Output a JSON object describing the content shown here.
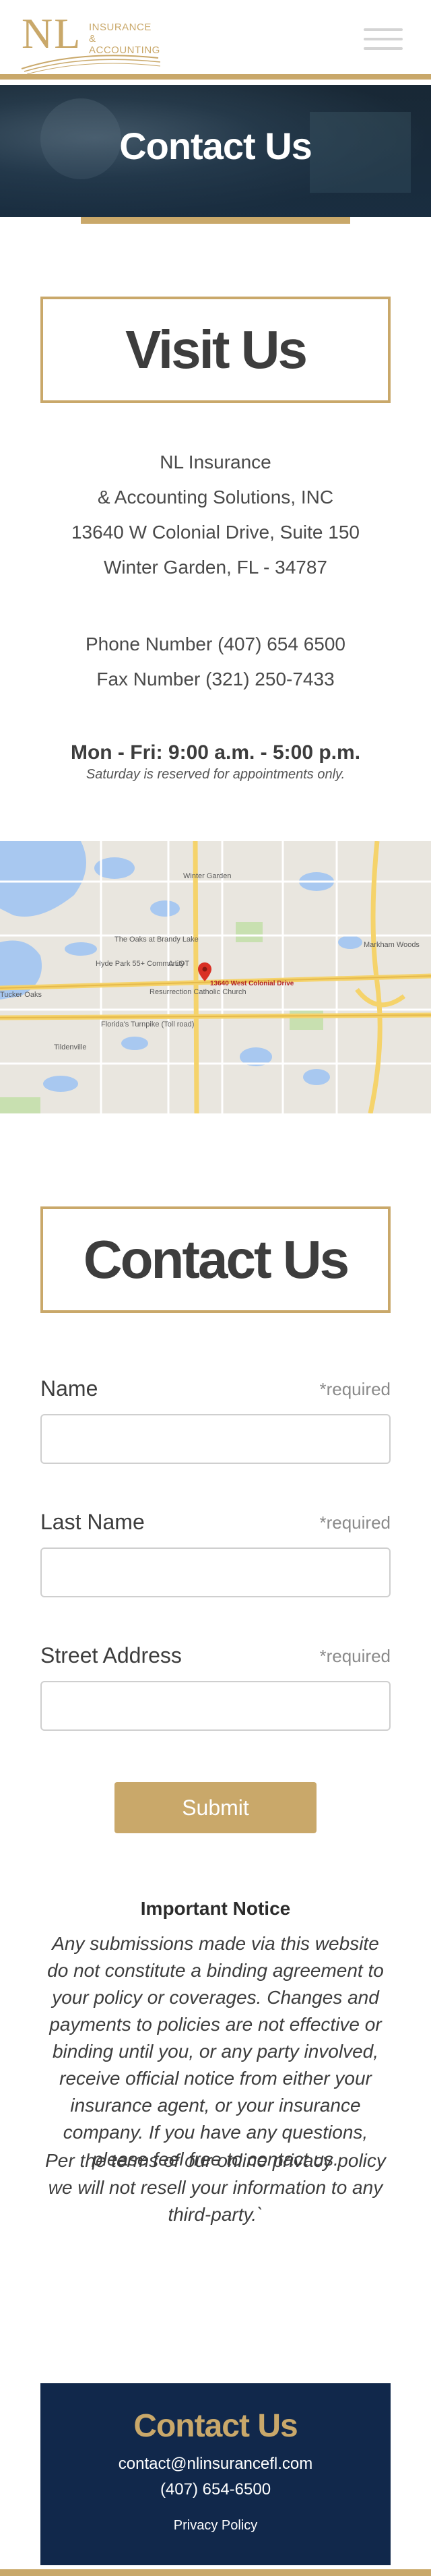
{
  "header": {
    "logo_letters": "NL",
    "logo_line1": "Insurance",
    "logo_line2": "& Accounting",
    "menu_icon": "hamburger-icon"
  },
  "hero": {
    "title": "Contact Us"
  },
  "visit": {
    "title": "Visit Us",
    "address": {
      "line1": "NL Insurance",
      "line2": "& Accounting Solutions, INC",
      "line3": "13640 W Colonial Drive, Suite 150",
      "line4": "Winter Garden, FL - 34787"
    },
    "phone": "Phone Number (407) 654 6500",
    "fax": "Fax Number (321) 250-7433",
    "hours": "Mon - Fri: 9:00 a.m. - 5:00 p.m.",
    "hours_note": "Saturday is reserved for appointments only."
  },
  "map": {
    "labels": {
      "winter_garden": "Winter Garden",
      "oaks": "The Oaks at Brandy Lake",
      "hyde_park": "Hyde Park 55+ Community",
      "alot": "A LOT",
      "resurrection": "Resurrection Catholic Church",
      "markham": "Markham Woods",
      "tucker": "Tucker Oaks",
      "tildenville": "Tildenville",
      "turnpike": "Florida's Turnpike (Toll road)",
      "pin": "13640 West Colonial Drive"
    },
    "pin_icon": "map-pin-icon"
  },
  "contact_form": {
    "title": "Contact Us",
    "required": "*required",
    "fields": {
      "name": {
        "label": "Name",
        "value": ""
      },
      "last_name": {
        "label": "Last Name",
        "value": ""
      },
      "street": {
        "label": "Street Address",
        "value": ""
      }
    },
    "submit_label": "Submit"
  },
  "notice": {
    "title": "Important Notice",
    "body": "Any submissions made via this website do not constitute a binding agreement to your policy or coverages. Changes and payments to policies are not effective or binding until you, or any party involved, receive official notice from either your insurance agent, or your insurance company. If you have any questions, please feel free to contact us.",
    "privacy": "Per the terms of our online privacy policy we will not resell your information to any third-party.`"
  },
  "footer": {
    "title": "Contact Us",
    "email": "contact@nlinsurancefl.com",
    "phone": "(407) 654-6500",
    "privacy_link": "Privacy Policy"
  },
  "colors": {
    "gold": "#c9a86a",
    "navy": "#11284b",
    "text": "#3d3d3d"
  }
}
